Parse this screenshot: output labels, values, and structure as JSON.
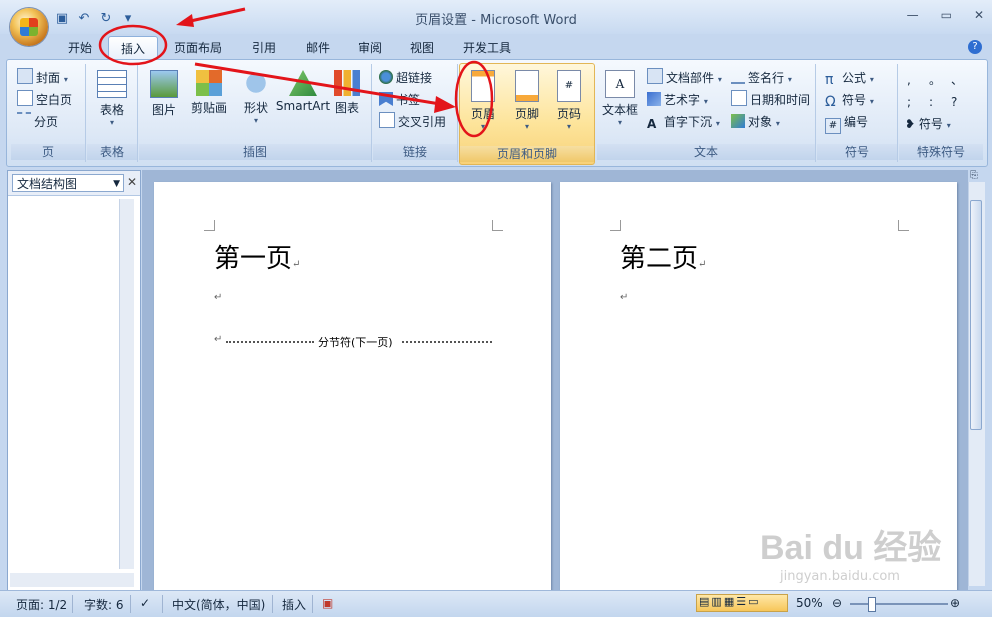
{
  "window": {
    "title": "页眉设置 - Microsoft Word"
  },
  "quick_access": {
    "icons": [
      "save-icon",
      "undo-icon",
      "redo-icon",
      "customize-icon"
    ]
  },
  "tabs": [
    "开始",
    "插入",
    "页面布局",
    "引用",
    "邮件",
    "审阅",
    "视图",
    "开发工具"
  ],
  "active_tab": "插入",
  "ribbon": {
    "page_group": {
      "label": "页",
      "items": [
        "封面",
        "空白页",
        "分页"
      ]
    },
    "table_group": {
      "label": "表格",
      "button": "表格"
    },
    "illustrations_group": {
      "label": "插图",
      "buttons": [
        "图片",
        "剪贴画",
        "形状",
        "SmartArt",
        "图表"
      ]
    },
    "links_group": {
      "label": "链接",
      "items": [
        "超链接",
        "书签",
        "交叉引用"
      ]
    },
    "header_footer_group": {
      "label": "页眉和页脚",
      "buttons": [
        "页眉",
        "页脚",
        "页码"
      ]
    },
    "text_group": {
      "label": "文本",
      "big": "文本框",
      "items": [
        "文档部件",
        "艺术字",
        "首字下沉",
        "签名行",
        "日期和时间",
        "对象"
      ]
    },
    "symbols_group": {
      "label": "符号",
      "items": [
        "公式",
        "符号",
        "编号"
      ]
    },
    "special_group": {
      "label": "特殊符号",
      "symbols": [
        ",",
        "。",
        "、",
        ";",
        ":",
        "?"
      ],
      "button": "符号"
    }
  },
  "nav_pane": {
    "dropdown": "文档结构图"
  },
  "document": {
    "page1": {
      "title": "第一页",
      "section_break": "分节符(下一页)"
    },
    "page2": {
      "title": "第二页"
    }
  },
  "status": {
    "page": "页面: 1/2",
    "words": "字数: 6",
    "language": "中文(简体，中国)",
    "mode": "插入",
    "zoom": "50%"
  },
  "colors": {
    "annotation": "#e3141a",
    "accent": "#2f6ed1"
  },
  "watermark": {
    "brand": "Bai du 经验",
    "url": "jingyan.baidu.com"
  }
}
